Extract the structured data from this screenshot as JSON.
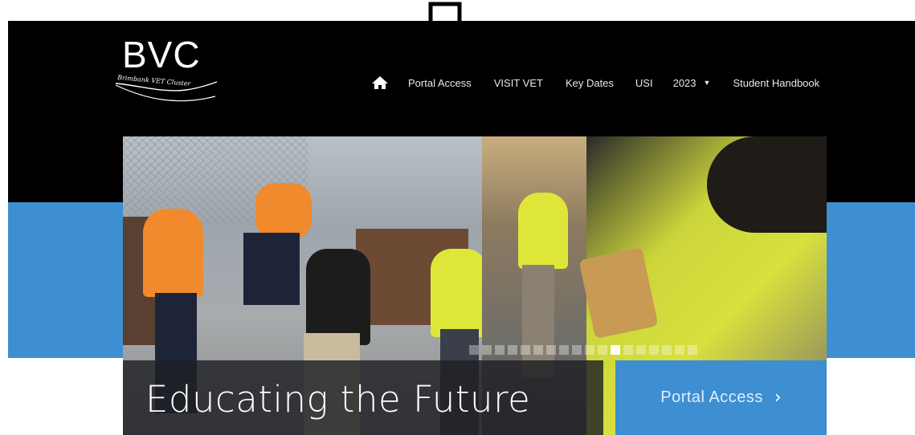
{
  "brand": {
    "logo_text": "BVC",
    "logo_subtext": "Brimbank VET Cluster"
  },
  "nav": {
    "home_icon": "home-icon",
    "items": [
      "Portal Access",
      "VISIT VET",
      "Key Dates",
      "USI",
      "2023",
      "Student Handbook"
    ]
  },
  "hero": {
    "caption": "Educating the Future",
    "cta_label": "Portal Access",
    "slide_count": 18,
    "active_slide": 11
  },
  "colors": {
    "header_bg": "#000000",
    "accent_blue": "#3d8fd1",
    "annotation_arrow": "#000000"
  }
}
